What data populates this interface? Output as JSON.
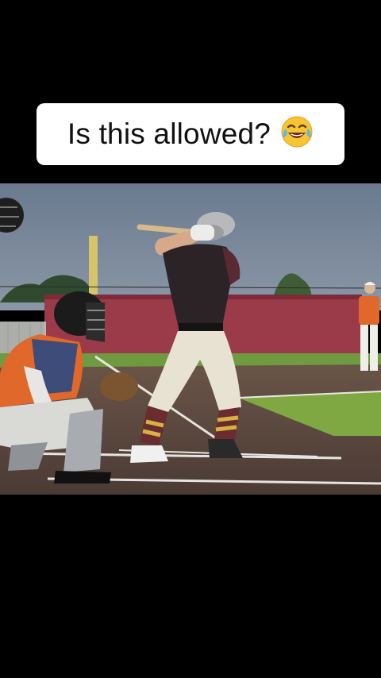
{
  "caption": {
    "text": "Is this allowed?",
    "emoji": "face-with-tears-of-joy-icon"
  },
  "photo": {
    "subject": "baseball-batter-scene"
  },
  "colors": {
    "background": "#000000",
    "caption_bg": "#ffffff",
    "sky": "#6f7f92",
    "outfield_wall": "#9b3a48",
    "grass": "#7fa843",
    "dirt": "#5a4740",
    "batter_jersey": "#2b2326",
    "catcher_jersey": "#e0682b"
  }
}
